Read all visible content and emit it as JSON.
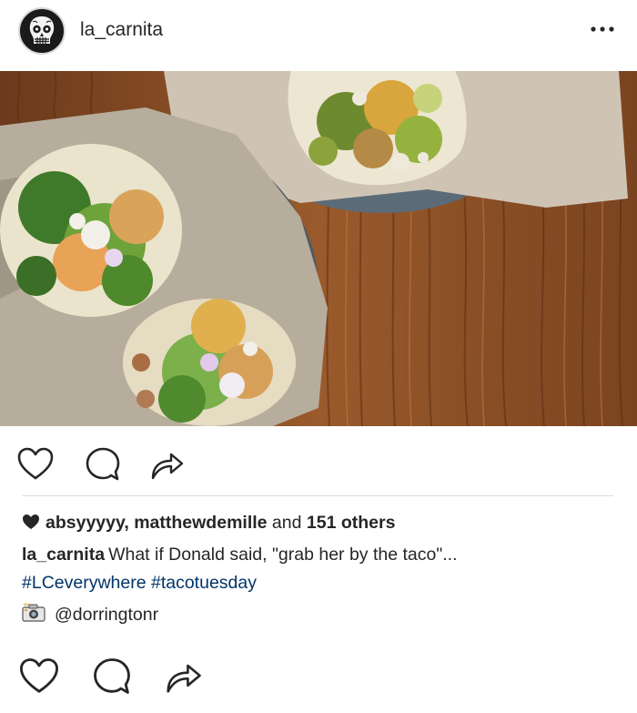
{
  "post": {
    "username": "la_carnita",
    "more_icon": "more-horizontal-icon"
  },
  "photo": {
    "alt_icon": "photo"
  },
  "actions": {
    "like_icon": "heart-outline-icon",
    "comment_icon": "comment-icon",
    "share_icon": "share-arrow-icon"
  },
  "likes": {
    "users": "absyyyyy, matthewdemille",
    "connector": " and ",
    "others": "151 others"
  },
  "caption": {
    "username": "la_carnita",
    "text": "What if Donald said, \"grab her by the taco\"...",
    "hashtags": "#LCeverywhere #tacotuesday"
  },
  "credit": {
    "handle": "@dorringtonr",
    "icon": "camera-icon"
  },
  "colors": {
    "text": "#262626",
    "hashtag": "#003569",
    "divider": "#dbdbdb"
  }
}
